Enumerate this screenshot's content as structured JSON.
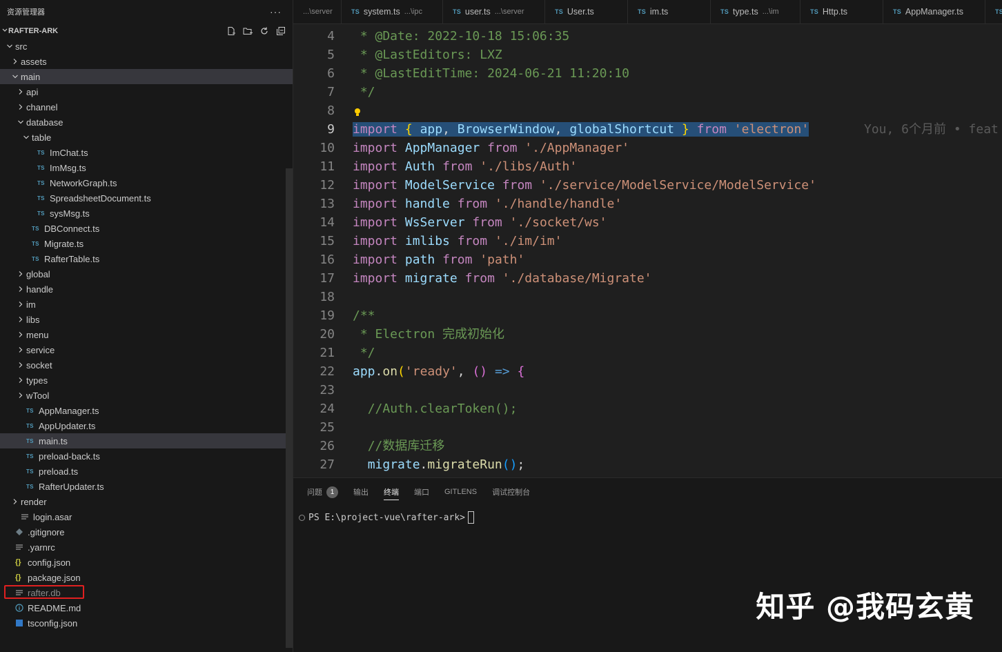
{
  "explorer": {
    "title": "资源管理器",
    "more": "···",
    "project": "RAFTER-ARK"
  },
  "tree": [
    {
      "label": "src",
      "kind": "folder-open",
      "depth": 0
    },
    {
      "label": "assets",
      "kind": "folder",
      "depth": 1
    },
    {
      "label": "main",
      "kind": "folder-open",
      "depth": 1,
      "selected": true
    },
    {
      "label": "api",
      "kind": "folder",
      "depth": 2
    },
    {
      "label": "channel",
      "kind": "folder",
      "depth": 2
    },
    {
      "label": "database",
      "kind": "folder-open",
      "depth": 2
    },
    {
      "label": "table",
      "kind": "folder-open",
      "depth": 3
    },
    {
      "label": "ImChat.ts",
      "kind": "ts",
      "depth": 4
    },
    {
      "label": "ImMsg.ts",
      "kind": "ts",
      "depth": 4
    },
    {
      "label": "NetworkGraph.ts",
      "kind": "ts",
      "depth": 4
    },
    {
      "label": "SpreadsheetDocument.ts",
      "kind": "ts",
      "depth": 4
    },
    {
      "label": "sysMsg.ts",
      "kind": "ts",
      "depth": 4
    },
    {
      "label": "DBConnect.ts",
      "kind": "ts",
      "depth": 3
    },
    {
      "label": "Migrate.ts",
      "kind": "ts",
      "depth": 3
    },
    {
      "label": "RafterTable.ts",
      "kind": "ts",
      "depth": 3
    },
    {
      "label": "global",
      "kind": "folder",
      "depth": 2
    },
    {
      "label": "handle",
      "kind": "folder",
      "depth": 2
    },
    {
      "label": "im",
      "kind": "folder",
      "depth": 2
    },
    {
      "label": "libs",
      "kind": "folder",
      "depth": 2
    },
    {
      "label": "menu",
      "kind": "folder",
      "depth": 2
    },
    {
      "label": "service",
      "kind": "folder",
      "depth": 2
    },
    {
      "label": "socket",
      "kind": "folder",
      "depth": 2
    },
    {
      "label": "types",
      "kind": "folder",
      "depth": 2
    },
    {
      "label": "wTool",
      "kind": "folder",
      "depth": 2
    },
    {
      "label": "AppManager.ts",
      "kind": "ts",
      "depth": 2
    },
    {
      "label": "AppUpdater.ts",
      "kind": "ts",
      "depth": 2
    },
    {
      "label": "main.ts",
      "kind": "ts",
      "depth": 2,
      "selected": true
    },
    {
      "label": "preload-back.ts",
      "kind": "ts",
      "depth": 2
    },
    {
      "label": "preload.ts",
      "kind": "ts",
      "depth": 2
    },
    {
      "label": "RafterUpdater.ts",
      "kind": "ts",
      "depth": 2
    },
    {
      "label": "render",
      "kind": "folder",
      "depth": 1
    },
    {
      "label": "login.asar",
      "kind": "txt",
      "depth": 1
    },
    {
      "label": ".gitignore",
      "kind": "git",
      "depth": 0
    },
    {
      "label": ".yarnrc",
      "kind": "txt",
      "depth": 0
    },
    {
      "label": "config.json",
      "kind": "json",
      "depth": 0
    },
    {
      "label": "package.json",
      "kind": "json",
      "depth": 0
    },
    {
      "label": "rafter.db",
      "kind": "txt",
      "depth": 0,
      "dim": true,
      "highlight": true
    },
    {
      "label": "README.md",
      "kind": "info",
      "depth": 0
    },
    {
      "label": "tsconfig.json",
      "kind": "tsconfig",
      "depth": 0
    }
  ],
  "tabs": [
    {
      "name": "",
      "desc": "...\\server",
      "ts": false
    },
    {
      "name": "system.ts",
      "desc": "...\\ipc",
      "ts": true
    },
    {
      "name": "user.ts",
      "desc": "...\\server",
      "ts": true
    },
    {
      "name": "User.ts",
      "desc": "",
      "ts": true
    },
    {
      "name": "im.ts",
      "desc": "",
      "ts": true
    },
    {
      "name": "type.ts",
      "desc": "...\\im",
      "ts": true
    },
    {
      "name": "Http.ts",
      "desc": "",
      "ts": true
    },
    {
      "name": "AppManager.ts",
      "desc": "",
      "ts": true
    },
    {
      "name": "",
      "desc": "",
      "ts": true
    }
  ],
  "editor": {
    "active_line": 9,
    "blame": "You, 6个月前 • feat",
    "lines": [
      {
        "n": 4,
        "tokens": [
          [
            "cmt",
            " * @Date: 2022-10-18 15:06:35"
          ]
        ]
      },
      {
        "n": 5,
        "tokens": [
          [
            "cmt",
            " * @LastEditors: LXZ"
          ]
        ]
      },
      {
        "n": 6,
        "tokens": [
          [
            "cmt",
            " * @LastEditTime: 2024-06-21 11:20:10"
          ]
        ]
      },
      {
        "n": 7,
        "tokens": [
          [
            "cmt",
            " */"
          ]
        ]
      },
      {
        "n": 8,
        "tokens": [],
        "bulb": true
      },
      {
        "n": 9,
        "selected": true,
        "tokens": [
          [
            "kw2",
            "import"
          ],
          [
            "pun",
            " "
          ],
          [
            "brk3",
            "{"
          ],
          [
            "pun",
            " "
          ],
          [
            "var",
            "app"
          ],
          [
            "pun",
            ", "
          ],
          [
            "var",
            "BrowserWindow"
          ],
          [
            "pun",
            ", "
          ],
          [
            "var",
            "globalShortcut"
          ],
          [
            "pun",
            " "
          ],
          [
            "brk3",
            "}"
          ],
          [
            "pun",
            " "
          ],
          [
            "kw2",
            "from"
          ],
          [
            "pun",
            " "
          ],
          [
            "str",
            "'electron'"
          ]
        ]
      },
      {
        "n": 10,
        "tokens": [
          [
            "kw2",
            "import"
          ],
          [
            "pun",
            " "
          ],
          [
            "var",
            "AppManager"
          ],
          [
            "pun",
            " "
          ],
          [
            "kw2",
            "from"
          ],
          [
            "pun",
            " "
          ],
          [
            "str",
            "'./AppManager'"
          ]
        ]
      },
      {
        "n": 11,
        "tokens": [
          [
            "kw2",
            "import"
          ],
          [
            "pun",
            " "
          ],
          [
            "var",
            "Auth"
          ],
          [
            "pun",
            " "
          ],
          [
            "kw2",
            "from"
          ],
          [
            "pun",
            " "
          ],
          [
            "str",
            "'./libs/Auth'"
          ]
        ]
      },
      {
        "n": 12,
        "tokens": [
          [
            "kw2",
            "import"
          ],
          [
            "pun",
            " "
          ],
          [
            "var",
            "ModelService"
          ],
          [
            "pun",
            " "
          ],
          [
            "kw2",
            "from"
          ],
          [
            "pun",
            " "
          ],
          [
            "str",
            "'./service/ModelService/ModelService'"
          ]
        ]
      },
      {
        "n": 13,
        "tokens": [
          [
            "kw2",
            "import"
          ],
          [
            "pun",
            " "
          ],
          [
            "var",
            "handle"
          ],
          [
            "pun",
            " "
          ],
          [
            "kw2",
            "from"
          ],
          [
            "pun",
            " "
          ],
          [
            "str",
            "'./handle/handle'"
          ]
        ]
      },
      {
        "n": 14,
        "tokens": [
          [
            "kw2",
            "import"
          ],
          [
            "pun",
            " "
          ],
          [
            "var",
            "WsServer"
          ],
          [
            "pun",
            " "
          ],
          [
            "kw2",
            "from"
          ],
          [
            "pun",
            " "
          ],
          [
            "str",
            "'./socket/ws'"
          ]
        ]
      },
      {
        "n": 15,
        "tokens": [
          [
            "kw2",
            "import"
          ],
          [
            "pun",
            " "
          ],
          [
            "var",
            "imlibs"
          ],
          [
            "pun",
            " "
          ],
          [
            "kw2",
            "from"
          ],
          [
            "pun",
            " "
          ],
          [
            "str",
            "'./im/im'"
          ]
        ]
      },
      {
        "n": 16,
        "tokens": [
          [
            "kw2",
            "import"
          ],
          [
            "pun",
            " "
          ],
          [
            "var",
            "path"
          ],
          [
            "pun",
            " "
          ],
          [
            "kw2",
            "from"
          ],
          [
            "pun",
            " "
          ],
          [
            "str",
            "'path'"
          ]
        ]
      },
      {
        "n": 17,
        "tokens": [
          [
            "kw2",
            "import"
          ],
          [
            "pun",
            " "
          ],
          [
            "var",
            "migrate"
          ],
          [
            "pun",
            " "
          ],
          [
            "kw2",
            "from"
          ],
          [
            "pun",
            " "
          ],
          [
            "str",
            "'./database/Migrate'"
          ]
        ]
      },
      {
        "n": 18,
        "tokens": []
      },
      {
        "n": 19,
        "tokens": [
          [
            "cmt",
            "/**"
          ]
        ]
      },
      {
        "n": 20,
        "tokens": [
          [
            "cmt",
            " * Electron 完成初始化"
          ]
        ]
      },
      {
        "n": 21,
        "tokens": [
          [
            "cmt",
            " */"
          ]
        ]
      },
      {
        "n": 22,
        "tokens": [
          [
            "var",
            "app"
          ],
          [
            "pun",
            "."
          ],
          [
            "fn",
            "on"
          ],
          [
            "brk3",
            "("
          ],
          [
            "str",
            "'ready'"
          ],
          [
            "pun",
            ", "
          ],
          [
            "brk",
            "()"
          ],
          [
            "pun",
            " "
          ],
          [
            "kw",
            "=>"
          ],
          [
            "pun",
            " "
          ],
          [
            "brk",
            "{"
          ]
        ]
      },
      {
        "n": 23,
        "tokens": []
      },
      {
        "n": 24,
        "tokens": [
          [
            "pun",
            "  "
          ],
          [
            "cmt",
            "//Auth.clearToken();"
          ]
        ]
      },
      {
        "n": 25,
        "tokens": []
      },
      {
        "n": 26,
        "tokens": [
          [
            "pun",
            "  "
          ],
          [
            "cmt",
            "//数据库迁移"
          ]
        ]
      },
      {
        "n": 27,
        "tokens": [
          [
            "pun",
            "  "
          ],
          [
            "var",
            "migrate"
          ],
          [
            "pun",
            "."
          ],
          [
            "fn",
            "migrateRun"
          ],
          [
            "brk2",
            "()"
          ],
          [
            "pun",
            ";"
          ]
        ]
      }
    ]
  },
  "panel": {
    "tabs": [
      {
        "label": "问题",
        "badge": "1"
      },
      {
        "label": "输出"
      },
      {
        "label": "终端",
        "active": true
      },
      {
        "label": "端口"
      },
      {
        "label": "GITLENS"
      },
      {
        "label": "调试控制台"
      }
    ],
    "prompt": "PS E:\\project-vue\\rafter-ark>"
  },
  "watermark": "知乎 @我码玄黄"
}
